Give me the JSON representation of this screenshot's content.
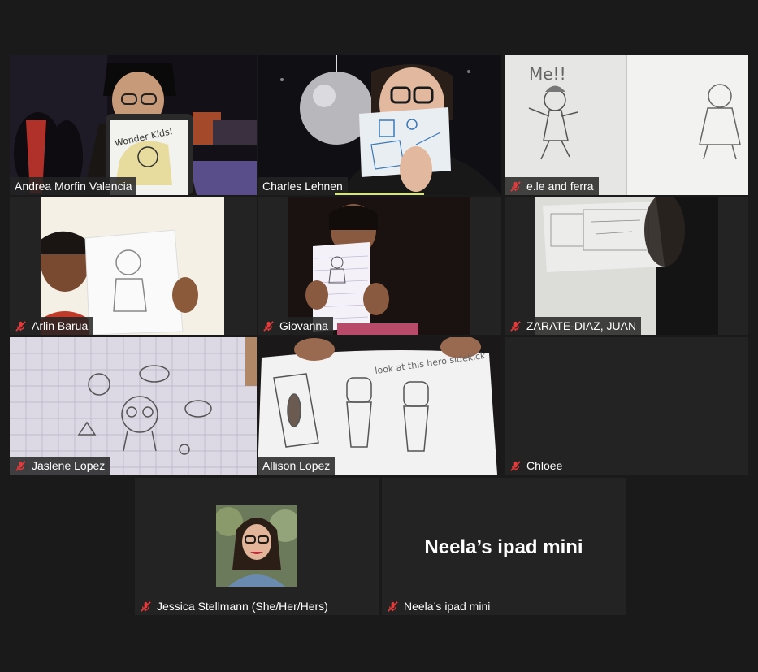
{
  "participants": [
    {
      "name": "Andrea Morfin Valencia",
      "muted": false,
      "active": true
    },
    {
      "name": "Charles Lehnen",
      "muted": false,
      "speaking": true
    },
    {
      "name": "e.le and ferra",
      "muted": true
    },
    {
      "name": "Arlin Barua",
      "muted": true
    },
    {
      "name": "Giovanna",
      "muted": true
    },
    {
      "name": "ZARATE-DIAZ, JUAN",
      "muted": true
    },
    {
      "name": "Jaslene Lopez",
      "muted": true
    },
    {
      "name": "Allison Lopez",
      "muted": false
    },
    {
      "name": "Chloee",
      "muted": true
    },
    {
      "name": "Jessica Stellmann (She/Her/Hers)",
      "muted": true
    },
    {
      "name": "Neela’s ipad mini",
      "muted": true
    }
  ],
  "neela_placeholder": "Neela’s ipad mini",
  "drawings": {
    "andrea_tablet": "Wonder Kids!",
    "ele_me": "Me!!",
    "allison_paper": "look at this hero sidekick"
  },
  "colors": {
    "accent": "#d7e38a",
    "muted": "#e23b3b",
    "tile": "#232323"
  }
}
